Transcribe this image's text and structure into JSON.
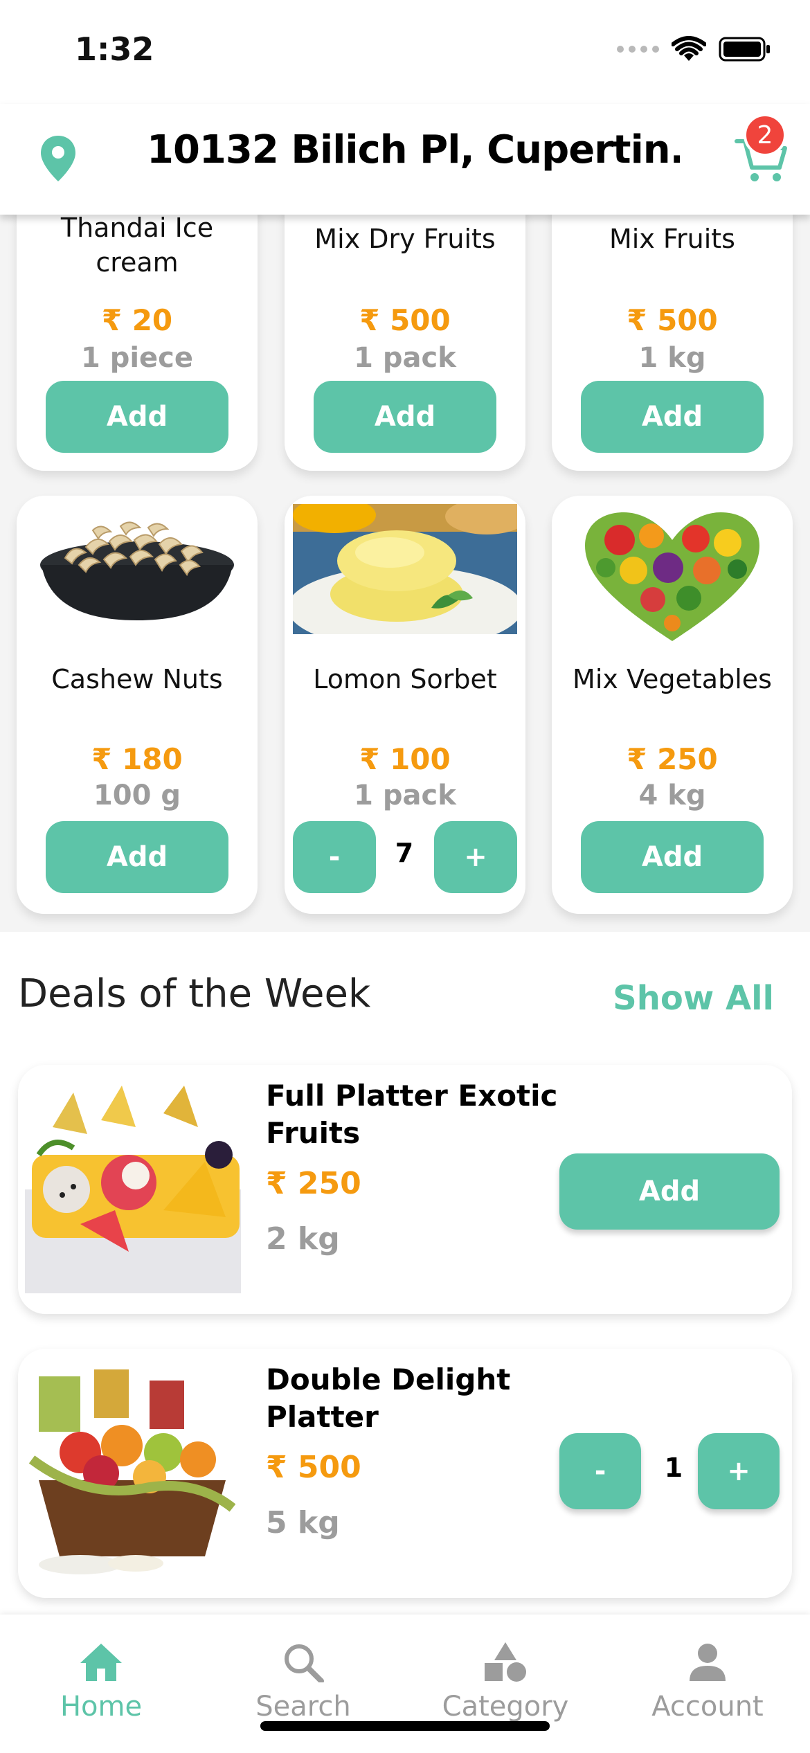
{
  "status": {
    "time": "1:32"
  },
  "header": {
    "address": "10132 Bilich Pl, Cupertin...",
    "cart_count": "2"
  },
  "colors": {
    "accent": "#5dc4a8",
    "price": "#f59a0f",
    "badge": "#f0443c"
  },
  "products_top_row": [
    {
      "name": "Thandai Ice cream",
      "price": "₹ 20",
      "unit": "1 piece",
      "action": "Add"
    },
    {
      "name": "Mix Dry Fruits",
      "price": "₹ 500",
      "unit": "1 pack",
      "action": "Add"
    },
    {
      "name": "Mix Fruits",
      "price": "₹ 500",
      "unit": "1 kg",
      "action": "Add"
    }
  ],
  "products_row2": [
    {
      "name": "Cashew Nuts",
      "price": "₹ 180",
      "unit": "100 g",
      "action": "Add",
      "image": "cashew-bowl"
    },
    {
      "name": "Lomon Sorbet",
      "price": "₹ 100",
      "unit": "1 pack",
      "quantity": "7",
      "minus": "-",
      "plus": "+",
      "image": "lemon-sorbet"
    },
    {
      "name": "Mix Vegetables",
      "price": "₹ 250",
      "unit": "4 kg",
      "action": "Add",
      "image": "vegetable-heart"
    }
  ],
  "deals": {
    "title": "Deals of the Week",
    "show_all": "Show All",
    "items": [
      {
        "name": "Full Platter Exotic Fruits",
        "price": "₹ 250",
        "unit": "2 kg",
        "action": "Add",
        "image": "exotic-fruit-platter"
      },
      {
        "name": "Double Delight Platter",
        "price": "₹ 500",
        "unit": "5 kg",
        "quantity": "1",
        "minus": "-",
        "plus": "+",
        "image": "fruit-basket"
      }
    ]
  },
  "tabs": [
    {
      "label": "Home",
      "icon": "home-icon",
      "active": true
    },
    {
      "label": "Search",
      "icon": "search-icon",
      "active": false
    },
    {
      "label": "Category",
      "icon": "category-icon",
      "active": false
    },
    {
      "label": "Account",
      "icon": "account-icon",
      "active": false
    }
  ]
}
